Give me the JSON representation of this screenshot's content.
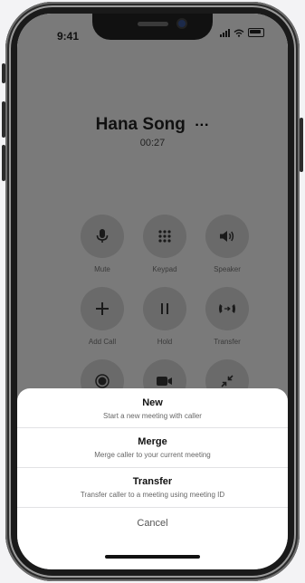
{
  "status_bar": {
    "time": "9:41"
  },
  "caller": {
    "name": "Hana Song",
    "more": "···",
    "duration": "00:27"
  },
  "controls": [
    {
      "label": "Mute",
      "icon": "mic-icon"
    },
    {
      "label": "Keypad",
      "icon": "keypad-icon"
    },
    {
      "label": "Speaker",
      "icon": "speaker-icon"
    },
    {
      "label": "Add Call",
      "icon": "plus-icon"
    },
    {
      "label": "Hold",
      "icon": "pause-icon"
    },
    {
      "label": "Transfer",
      "icon": "transfer-icon"
    },
    {
      "label": "",
      "icon": "record-icon"
    },
    {
      "label": "",
      "icon": "video-icon"
    },
    {
      "label": "",
      "icon": "minimize-icon"
    }
  ],
  "sheet": {
    "options": [
      {
        "title": "New",
        "subtitle": "Start a new meeting with caller"
      },
      {
        "title": "Merge",
        "subtitle": "Merge caller to your current meeting"
      },
      {
        "title": "Transfer",
        "subtitle": "Transfer caller to a meeting using meeting ID"
      }
    ],
    "cancel": "Cancel"
  },
  "colors": {
    "sheet_bg": "#ffffff",
    "overlay": "#7a7a7a",
    "button_fill": "#6a6a6a"
  }
}
